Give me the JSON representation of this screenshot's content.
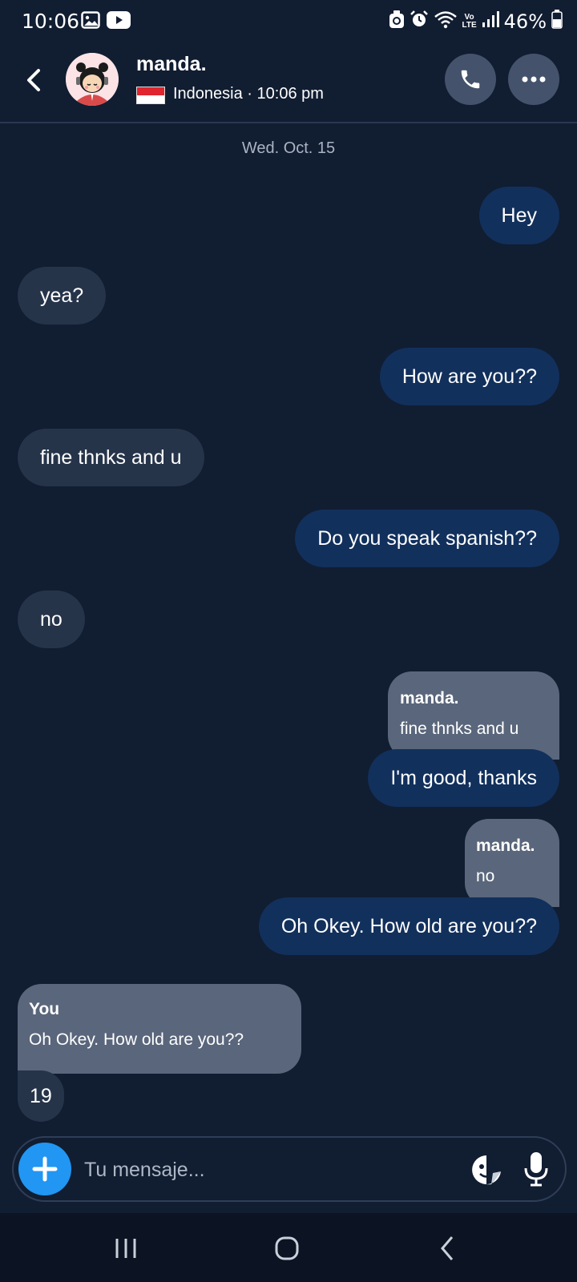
{
  "status_bar": {
    "time": "10:06",
    "battery": "46%",
    "left_icons": [
      "image-icon",
      "youtube-icon"
    ],
    "right_icons": [
      "recycle-icon",
      "alarm-icon",
      "wifi-icon",
      "volte-icon",
      "signal-icon",
      "battery-icon"
    ],
    "lte_top": "Vo",
    "lte_bottom": "LTE"
  },
  "header": {
    "contact_name": "manda.",
    "subtitle": "Indonesia · 10:06 pm",
    "flag": "indonesia",
    "accent_colors": {
      "header_button": "#44536b",
      "background": "#111d31"
    }
  },
  "date_separator": "Wed. Oct. 15",
  "messages": [
    {
      "from": "me",
      "text": "Hey"
    },
    {
      "from": "them",
      "text": "yea?"
    },
    {
      "from": "me",
      "text": "How are you??"
    },
    {
      "from": "them",
      "text": "fine thnks and u"
    },
    {
      "from": "me",
      "text": "Do you speak spanish??"
    },
    {
      "from": "them",
      "text": "no"
    },
    {
      "from": "me",
      "quote": {
        "name": "manda.",
        "text": "fine thnks and u"
      },
      "text": "I'm good, thanks"
    },
    {
      "from": "me",
      "quote": {
        "name": "manda.",
        "text": "no"
      },
      "text": "Oh Okey. How old are you??"
    },
    {
      "from": "them",
      "quote": {
        "name": "You",
        "text": "Oh Okey. How old are you??"
      },
      "text": "19"
    }
  ],
  "colors": {
    "outgoing_bubble": "#12305c",
    "incoming_bubble": "#26344a",
    "quote_bubble": "#5a667b",
    "plus_button": "#2196f3"
  },
  "composer": {
    "placeholder": "Tu mensaje...",
    "value": ""
  },
  "nav_bar": [
    "recents-icon",
    "home-icon",
    "back-icon"
  ]
}
